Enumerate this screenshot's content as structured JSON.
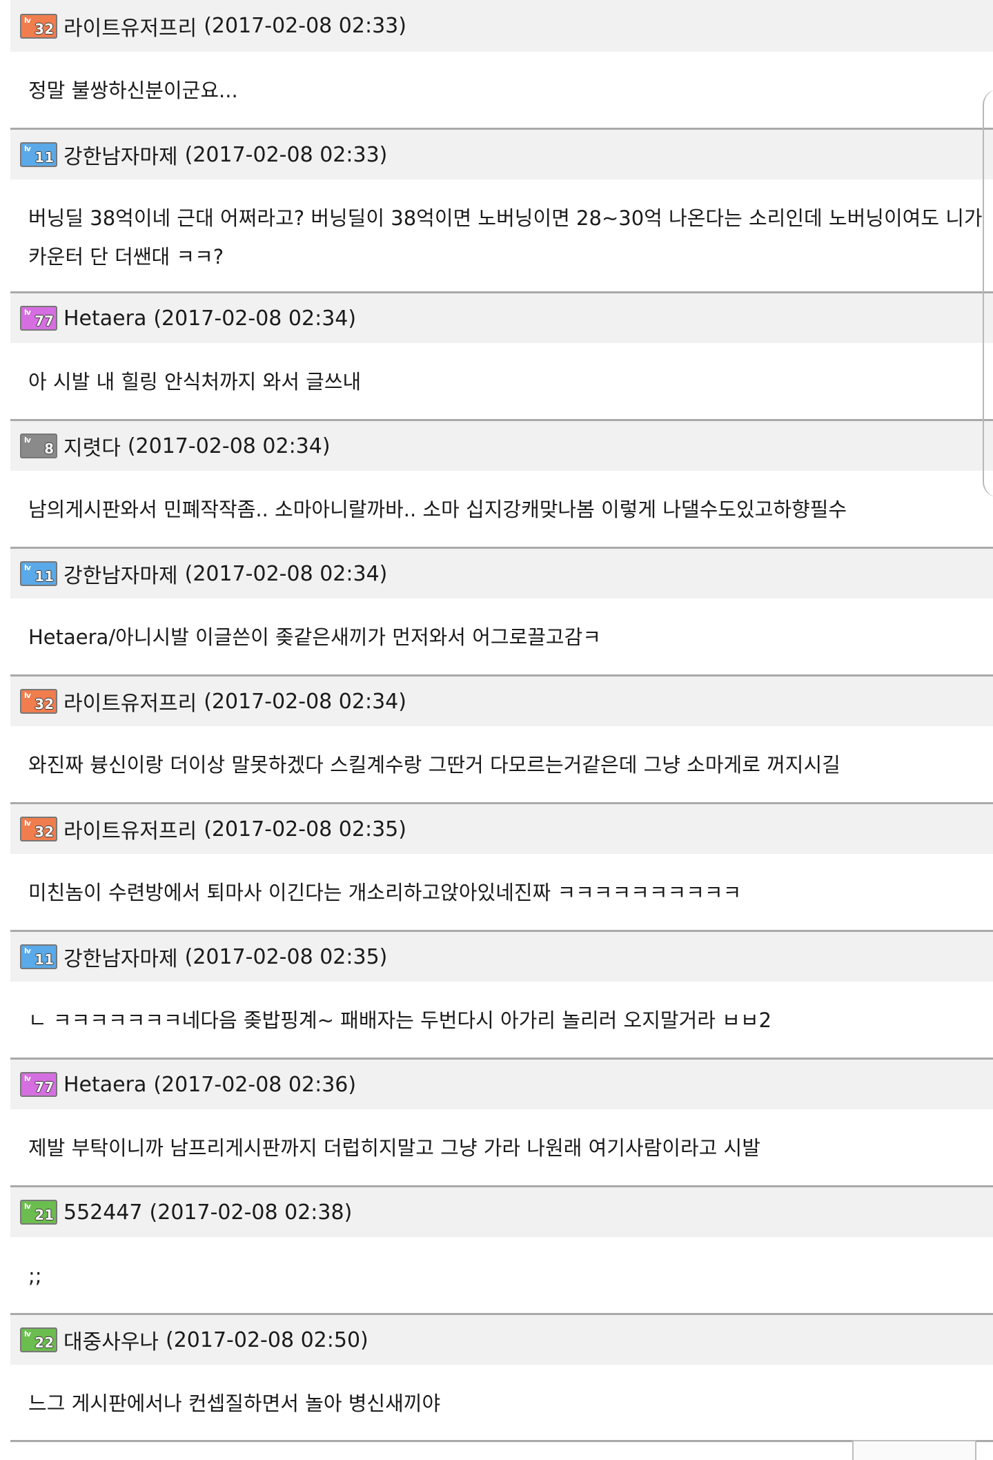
{
  "comments": [
    {
      "badge": {
        "level": "32",
        "color": "#f07d4e"
      },
      "username": "라이트유저프리",
      "timestamp": "(2017-02-08 02:33)",
      "text": "정말 불쌍하신분이군요..."
    },
    {
      "badge": {
        "level": "11",
        "color": "#5aa9e8"
      },
      "username": "강한남자마제",
      "timestamp": "(2017-02-08 02:33)",
      "text": "버닝딜 38억이네 근대 어쩌라고? 버닝딜이 38억이면 노버닝이면 28~30억 나온다는 소리인데 노버닝이여도 니가 카운터 단 더쌘대 ㅋㅋ?"
    },
    {
      "badge": {
        "level": "77",
        "color": "#d56ee0"
      },
      "username": "Hetaera",
      "timestamp": "(2017-02-08 02:34)",
      "text": "아 시발 내 힐링 안식처까지 와서 글쓰내"
    },
    {
      "badge": {
        "level": "8",
        "color": "#8a8a8a"
      },
      "username": "지렷다",
      "timestamp": "(2017-02-08 02:34)",
      "text": "남의게시판와서 민폐작작좀.. 소마아니랄까바.. 소마 십지강캐맞나봄 이렇게 나댈수도있고하향필수"
    },
    {
      "badge": {
        "level": "11",
        "color": "#5aa9e8"
      },
      "username": "강한남자마제",
      "timestamp": "(2017-02-08 02:34)",
      "text": "Hetaera/아니시발 이글쓴이 좆같은새끼가 먼저와서 어그로끌고감ㅋ"
    },
    {
      "badge": {
        "level": "32",
        "color": "#f07d4e"
      },
      "username": "라이트유저프리",
      "timestamp": "(2017-02-08 02:34)",
      "text": "와진짜 븅신이랑 더이상 말못하겠다 스킬계수랑 그딴거 다모르는거같은데 그냥 소마게로 꺼지시길"
    },
    {
      "badge": {
        "level": "32",
        "color": "#f07d4e"
      },
      "username": "라이트유저프리",
      "timestamp": "(2017-02-08 02:35)",
      "text": "미친놈이 수련방에서 퇴마사 이긴다는 개소리하고앉아있네진짜 ㅋㅋㅋㅋㅋㅋㅋㅋㅋㅋ"
    },
    {
      "badge": {
        "level": "11",
        "color": "#5aa9e8"
      },
      "username": "강한남자마제",
      "timestamp": "(2017-02-08 02:35)",
      "text": "ㄴ ㅋㅋㅋㅋㅋㅋㅋ네다음 좆밥핑계~ 패배자는 두번다시 아가리 놀리러 오지말거라 ㅂㅂ2"
    },
    {
      "badge": {
        "level": "77",
        "color": "#d56ee0"
      },
      "username": "Hetaera",
      "timestamp": "(2017-02-08 02:36)",
      "text": "제발 부탁이니까 남프리게시판까지 더럽히지말고 그냥 가라 나원래 여기사람이라고 시발"
    },
    {
      "badge": {
        "level": "21",
        "color": "#6cbd4f"
      },
      "username": "552447",
      "timestamp": "(2017-02-08 02:38)",
      "text": ";;"
    },
    {
      "badge": {
        "level": "22",
        "color": "#6cbd4f"
      },
      "username": "대중사우나",
      "timestamp": "(2017-02-08 02:50)",
      "text": "느그 게시판에서나 컨셉질하면서 놀아 병신새끼야"
    }
  ],
  "badge_prefix": "lv"
}
